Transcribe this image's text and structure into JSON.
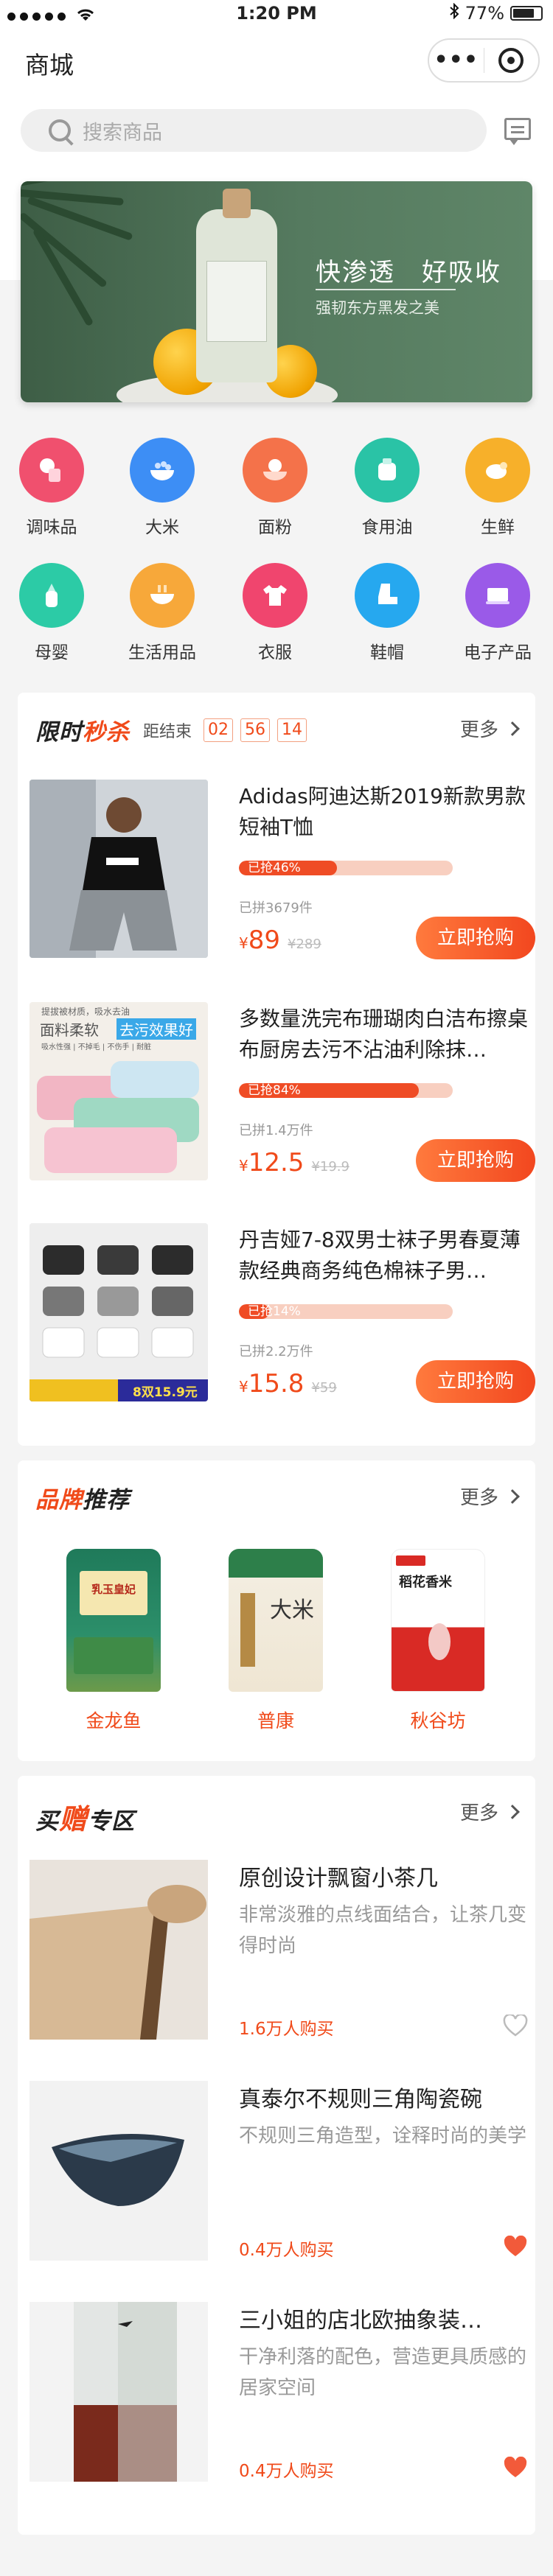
{
  "status_bar": {
    "time": "1:20 PM",
    "battery": "77%"
  },
  "nav": {
    "title": "商城",
    "more_label": "•••"
  },
  "search": {
    "placeholder": "搜索商品"
  },
  "banner": {
    "title": "快渗透　好吸收",
    "subtitle": "强韧东方黑发之美"
  },
  "categories": [
    {
      "label": "调味品",
      "icon": "seasoning-icon",
      "color": "#f0506e"
    },
    {
      "label": "大米",
      "icon": "rice-bowl-icon",
      "color": "#3d8ef5"
    },
    {
      "label": "面粉",
      "icon": "flour-bowl-icon",
      "color": "#f4724a"
    },
    {
      "label": "食用油",
      "icon": "oil-bottle-icon",
      "color": "#2ac3a6"
    },
    {
      "label": "生鲜",
      "icon": "fresh-fruit-icon",
      "color": "#f7b02a"
    },
    {
      "label": "母婴",
      "icon": "baby-bottle-icon",
      "color": "#2ccba6"
    },
    {
      "label": "生活用品",
      "icon": "daily-goods-icon",
      "color": "#f7a83a"
    },
    {
      "label": "衣服",
      "icon": "clothes-icon",
      "color": "#f0456e"
    },
    {
      "label": "鞋帽",
      "icon": "boot-icon",
      "color": "#26a8ef"
    },
    {
      "label": "电子产品",
      "icon": "electronics-icon",
      "color": "#9a5ae8"
    }
  ],
  "flash_sale": {
    "title_plain": "限时",
    "title_hot": "秒杀",
    "countdown_label": "距结束",
    "countdown": [
      "02",
      "56",
      "14"
    ],
    "more_label": "更多",
    "items": [
      {
        "title": "Adidas阿迪达斯2019新款男款短袖T恤",
        "progress_label": "已抢46%",
        "progress": 0.46,
        "sold": "已拼3679件",
        "price": "89",
        "original_price": "¥289",
        "button": "立即抢购"
      },
      {
        "title": "多数量洗完布珊瑚肉白洁布擦桌布厨房去污不沾油利除抹…",
        "progress_label": "已抢84%",
        "progress": 0.84,
        "sold": "已拼1.4万件",
        "price": "12.5",
        "original_price": "¥19.9",
        "button": "立即抢购",
        "image_text": [
          "提拔被材质，吸水去油",
          "面料柔软",
          "去污效果好",
          "吸水性强 | 不掉毛 | 不伤手 | 耐脏"
        ]
      },
      {
        "title": "丹吉娅7-8双男士袜子男春夏薄款经典商务纯色棉袜子男…",
        "progress_label": "已抢14%",
        "progress": 0.14,
        "sold": "已拼2.2万件",
        "price": "15.8",
        "original_price": "¥59",
        "button": "立即抢购",
        "image_text": [
          "8双15.9元"
        ]
      }
    ]
  },
  "brands": {
    "title_hot": "品牌",
    "title_plain": "推荐",
    "more_label": "更多",
    "items": [
      {
        "name": "金龙鱼",
        "pack_text": "乳玉皇妃"
      },
      {
        "name": "普康",
        "pack_text": "大米"
      },
      {
        "name": "秋谷坊",
        "pack_text": "稻花香米"
      }
    ]
  },
  "buy_gift": {
    "title_plain1": "买",
    "title_hot": "赠",
    "title_plain2": "专区",
    "more_label": "更多",
    "items": [
      {
        "title": "原创设计飘窗小茶几",
        "desc": "非常淡雅的点线面结合，让茶几变得时尚",
        "count": "1.6万人购买",
        "liked": false
      },
      {
        "title": "真泰尔不规则三角陶瓷碗",
        "desc": "不规则三角造型，诠释时尚的美学",
        "count": "0.4万人购买",
        "liked": true
      },
      {
        "title": "三小姐的店北欧抽象装…",
        "desc": "干净利落的配色，营造更具质感的居家空间",
        "count": "0.4万人购买",
        "liked": true
      }
    ]
  }
}
